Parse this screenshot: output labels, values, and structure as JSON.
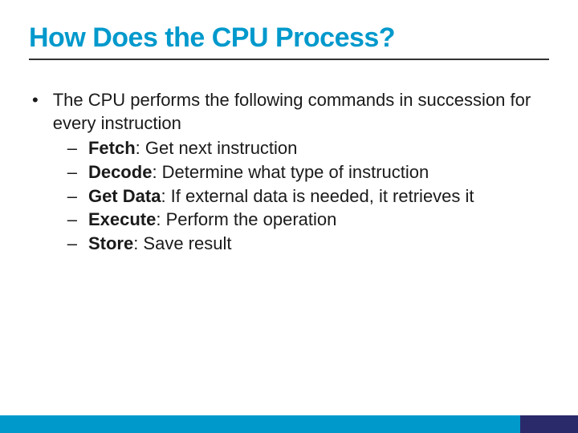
{
  "title": "How Does the CPU Process?",
  "main_bullet": "The CPU performs the following commands in succession for every instruction",
  "steps": [
    {
      "term": "Fetch",
      "desc": ": Get next instruction"
    },
    {
      "term": "Decode",
      "desc": ": Determine what type of instruction"
    },
    {
      "term": "Get Data",
      "desc": ": If external data is needed, it retrieves it"
    },
    {
      "term": "Execute",
      "desc": ": Perform the operation"
    },
    {
      "term": "Store",
      "desc": ": Save result"
    }
  ]
}
